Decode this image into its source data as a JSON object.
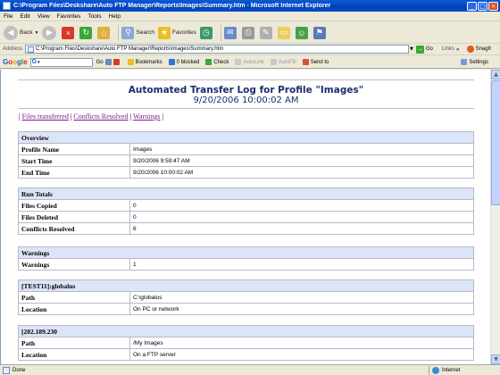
{
  "window": {
    "title": "C:\\Program Files\\Deskshare\\Auto FTP Manager\\Reports\\Images\\Summary.htm - Microsoft Internet Explorer"
  },
  "menubar": [
    "File",
    "Edit",
    "View",
    "Favorites",
    "Tools",
    "Help"
  ],
  "toolbar": {
    "back": "Back",
    "search": "Search",
    "favorites": "Favorites"
  },
  "addressbar": {
    "label": "Address",
    "value": "C:\\Program Files\\Deskshare\\Auto FTP Manager\\Reports\\Images\\Summary.htm",
    "go": "Go",
    "links": "Links",
    "snagit": "SnagIt"
  },
  "googlebar": {
    "logo": [
      "G",
      "o",
      "o",
      "g",
      "l",
      "e"
    ],
    "go": "Go",
    "bookmarks": "Bookmarks",
    "blocked": "0 blocked",
    "check": "Check",
    "autolink": "AutoLink",
    "autofill": "AutoFill",
    "sendto": "Send to",
    "settings": "Settings"
  },
  "page": {
    "title": "Automated Transfer Log for Profile \"Images\"",
    "date": "9/20/2006 10:00:02 AM",
    "nav": {
      "sep_start": "|",
      "files_transferred": "Files transferred",
      "sep1": "|",
      "conflicts_resolved": "Conflicts Resolved",
      "sep2": "|",
      "warnings": "Warnings",
      "sep_end": "|"
    },
    "overview": {
      "header": "Overview",
      "rows": [
        {
          "label": "Profile Name",
          "value": "Images"
        },
        {
          "label": "Start Time",
          "value": "9/20/2006 9:59:47 AM"
        },
        {
          "label": "End Time",
          "value": "9/20/2006 10:00:02 AM"
        }
      ]
    },
    "run_totals": {
      "header": "Run Totals",
      "rows": [
        {
          "label": "Files Copied",
          "value": "0"
        },
        {
          "label": "Files Deleted",
          "value": "0"
        },
        {
          "label": "Conflicts Resolved",
          "value": "6"
        }
      ]
    },
    "warnings": {
      "header": "Warnings",
      "rows": [
        {
          "label": "Warnings",
          "value": "1"
        }
      ]
    },
    "site1": {
      "header": "[TEST11]:globalus",
      "rows": [
        {
          "label": "Path",
          "value": "C:\\globalus"
        },
        {
          "label": "Location",
          "value": "On PC or network"
        }
      ]
    },
    "site2": {
      "header": "[202.189.230",
      "rows": [
        {
          "label": "Path",
          "value": "/My Images"
        },
        {
          "label": "Location",
          "value": "On a FTP server"
        }
      ]
    }
  },
  "statusbar": {
    "status": "Done",
    "zone": "Internet"
  }
}
